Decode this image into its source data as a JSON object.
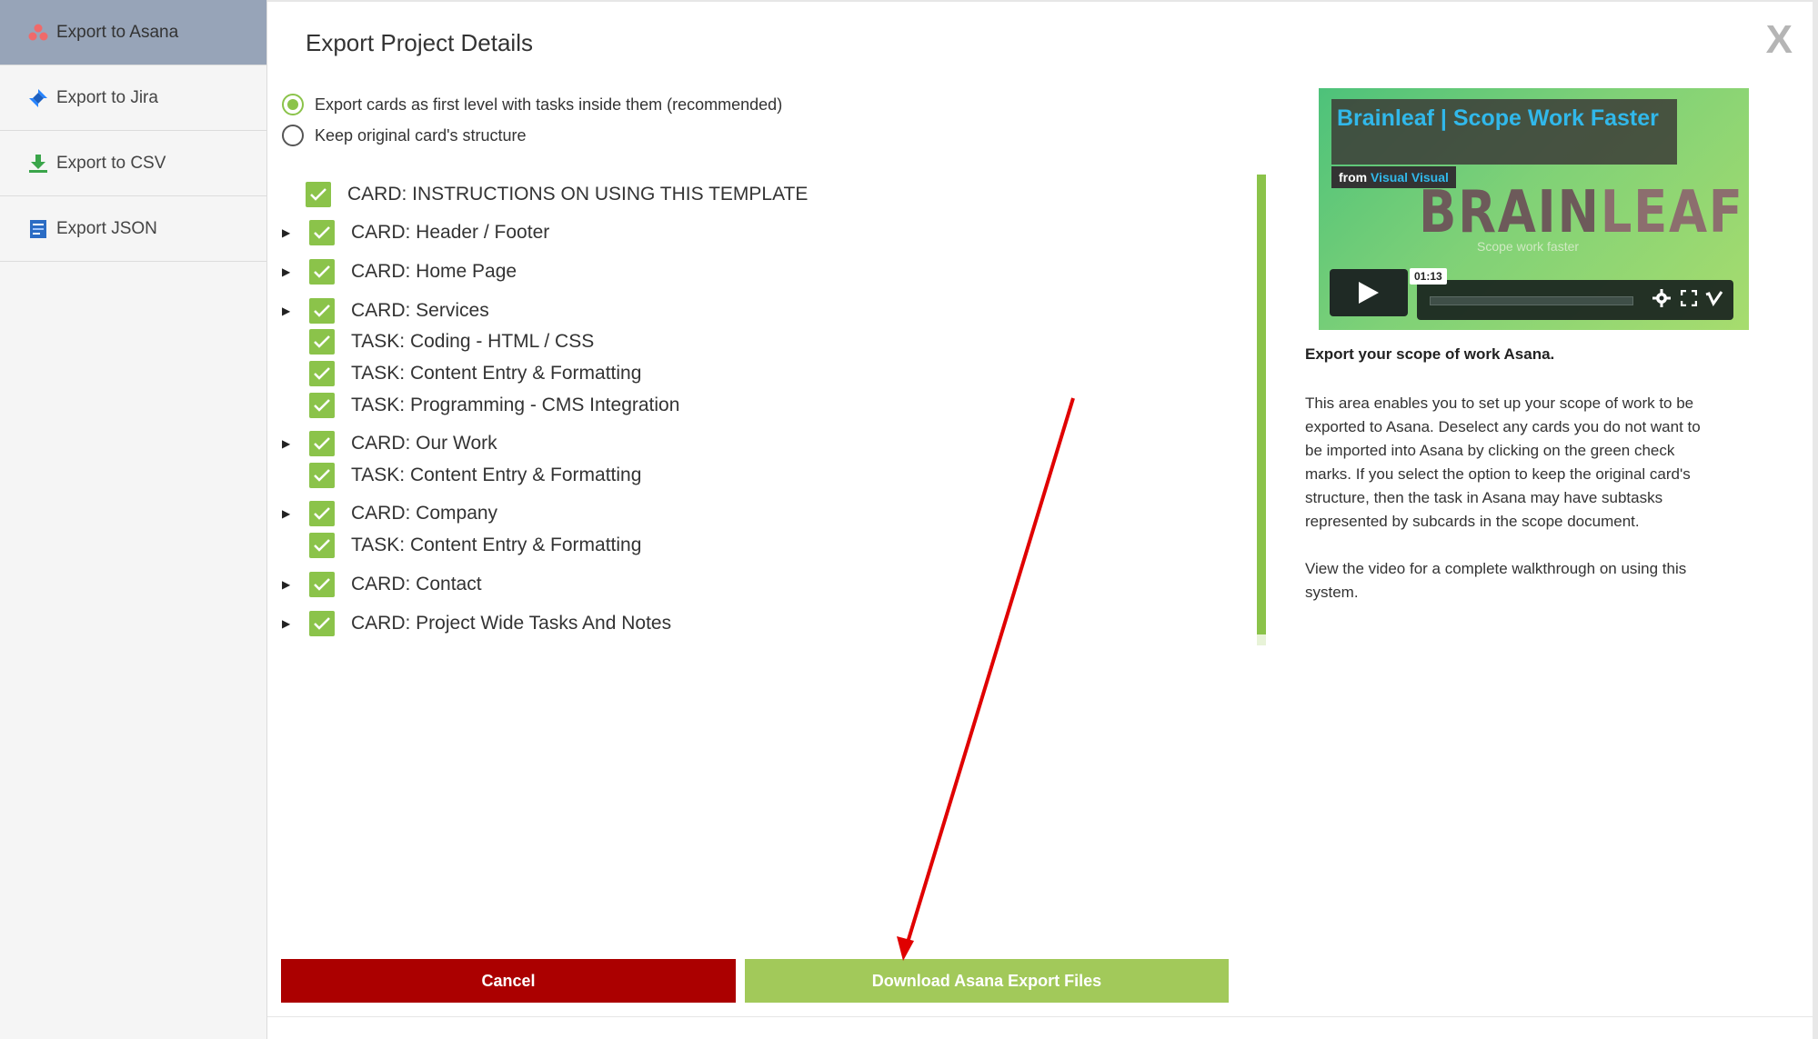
{
  "sidebar": {
    "items": [
      {
        "label": "Export to Asana",
        "active": true,
        "icon": "asana-icon"
      },
      {
        "label": "Export to Jira",
        "active": false,
        "icon": "jira-icon"
      },
      {
        "label": "Export to CSV",
        "active": false,
        "icon": "download-icon"
      },
      {
        "label": "Export JSON",
        "active": false,
        "icon": "json-file-icon"
      }
    ]
  },
  "header": {
    "title": "Export Project Details",
    "close_label": "X"
  },
  "options": {
    "first_level": "Export cards as first level with tasks inside them (recommended)",
    "original_structure": "Keep original card's structure",
    "selected": "first_level"
  },
  "tree": [
    {
      "label": "CARD: INSTRUCTIONS ON USING THIS TEMPLATE",
      "type": "card",
      "expandable": false,
      "checked": true
    },
    {
      "label": "CARD: Header / Footer",
      "type": "card",
      "expandable": true,
      "checked": true
    },
    {
      "label": "CARD: Home Page",
      "type": "card",
      "expandable": true,
      "checked": true
    },
    {
      "label": "CARD: Services",
      "type": "card",
      "expandable": true,
      "checked": true
    },
    {
      "label": "TASK: Coding - HTML / CSS",
      "type": "task",
      "expandable": false,
      "checked": true
    },
    {
      "label": "TASK: Content Entry & Formatting",
      "type": "task",
      "expandable": false,
      "checked": true
    },
    {
      "label": "TASK: Programming - CMS Integration",
      "type": "task",
      "expandable": false,
      "checked": true
    },
    {
      "label": "CARD: Our Work",
      "type": "card",
      "expandable": true,
      "checked": true
    },
    {
      "label": "TASK: Content Entry & Formatting",
      "type": "task",
      "expandable": false,
      "checked": true
    },
    {
      "label": "CARD: Company",
      "type": "card",
      "expandable": true,
      "checked": true
    },
    {
      "label": "TASK: Content Entry & Formatting",
      "type": "task",
      "expandable": false,
      "checked": true
    },
    {
      "label": "CARD: Contact",
      "type": "card",
      "expandable": true,
      "checked": true
    },
    {
      "label": "CARD: Project Wide Tasks And Notes",
      "type": "card",
      "expandable": true,
      "checked": true
    }
  ],
  "video": {
    "title": "Brainleaf | Scope Work Faster",
    "from_prefix": "from",
    "from_author": "Visual Visual",
    "logo_left": "BRAIN",
    "logo_right": "LEAF",
    "tagline": "Scope work faster",
    "time": "01:13"
  },
  "right_panel": {
    "heading": "Export your scope of work Asana.",
    "paragraph1": "This area enables you to set up your scope of work to be exported to Asana. Deselect any cards you do not want to be imported into Asana by clicking on the green check marks. If you select the option to keep the original card's structure, then the task in Asana may have subtasks represented by subcards in the scope document.",
    "paragraph2": "View the video for a complete walkthrough on using this system."
  },
  "buttons": {
    "cancel": "Cancel",
    "download": "Download Asana Export Files"
  },
  "colors": {
    "accent_green": "#8bc34a",
    "cancel_red": "#ab0000",
    "download_green": "#a2c95a",
    "sidebar_active": "#97a4b8",
    "annotation_arrow": "#e00000"
  }
}
